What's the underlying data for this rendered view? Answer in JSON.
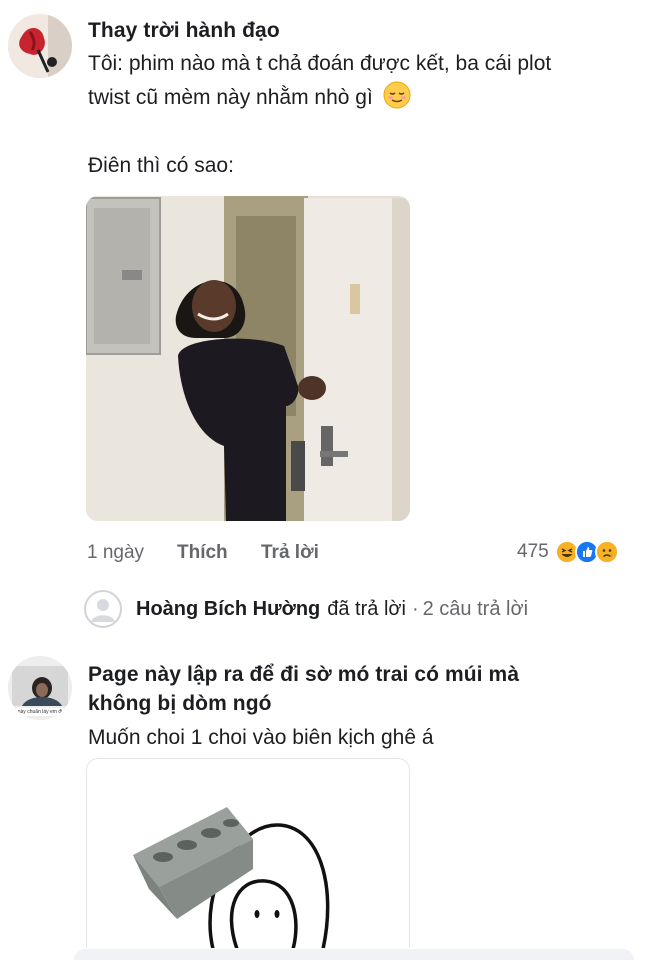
{
  "comment1": {
    "author": "Thay trời hành đạo",
    "line1": "Tôi: phim nào mà t chả đoán được kết, ba cái plot",
    "line2": "twist cũ mèm này nhằm nhò gì",
    "line2_emoji": "😌",
    "line3": "Điên thì có sao:",
    "time": "1 ngày",
    "like_label": "Thích",
    "reply_label": "Trả lời",
    "reaction_count": "475",
    "reactions": [
      "laugh-react-icon",
      "like-react-icon",
      "sad-react-icon"
    ]
  },
  "reply_preview": {
    "name": "Hoàng Bích Hường",
    "action": "đã trả lời",
    "separator": "·",
    "count_text": "2 câu trả lời"
  },
  "comment2": {
    "author_line1": "Page này lập ra để đi sờ mó trai có múi mà",
    "author_line2": "không bị dòm ngó",
    "text": "Muốn choi 1 choi vào biên kịch ghê á",
    "avatar_caption": "này chuẩn lấy em đi"
  }
}
